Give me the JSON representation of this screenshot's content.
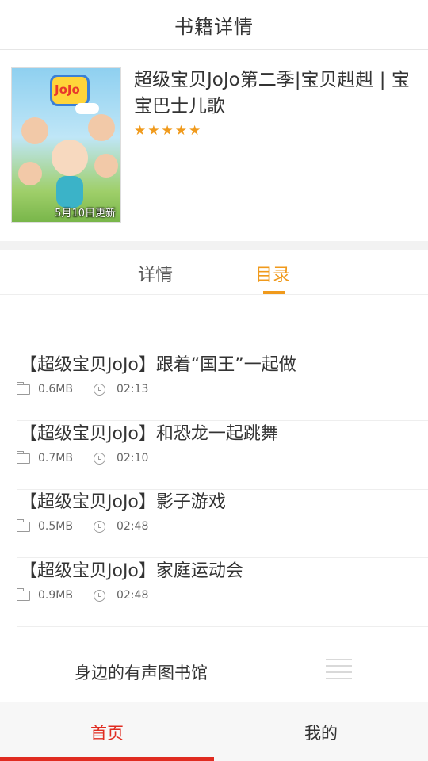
{
  "header": {
    "title": "书籍详情"
  },
  "book": {
    "title": "超级宝贝JoJo第二季|宝贝赳赳 | 宝宝巴士儿歌",
    "rating_stars": 5,
    "cover": {
      "logo_text": "JoJo",
      "update_label": "5月10日更新"
    }
  },
  "tabs": [
    {
      "label": "详情",
      "active": false
    },
    {
      "label": "目录",
      "active": true
    }
  ],
  "episodes": [
    {
      "title": "【超级宝贝JoJo】跟着“国王”一起做",
      "size": "0.6MB",
      "duration": "02:13"
    },
    {
      "title": "【超级宝贝JoJo】和恐龙一起跳舞",
      "size": "0.7MB",
      "duration": "02:10"
    },
    {
      "title": "【超级宝贝JoJo】影子游戏",
      "size": "0.5MB",
      "duration": "02:48"
    },
    {
      "title": "【超级宝贝JoJo】家庭运动会",
      "size": "0.9MB",
      "duration": "02:48"
    }
  ],
  "player_bar": {
    "library_label": "身边的有声图书馆"
  },
  "bottom_nav": [
    {
      "label": "首页",
      "active": true
    },
    {
      "label": "我的",
      "active": false
    }
  ],
  "colors": {
    "accent": "#f09a1c",
    "nav_active": "#e02b20"
  }
}
